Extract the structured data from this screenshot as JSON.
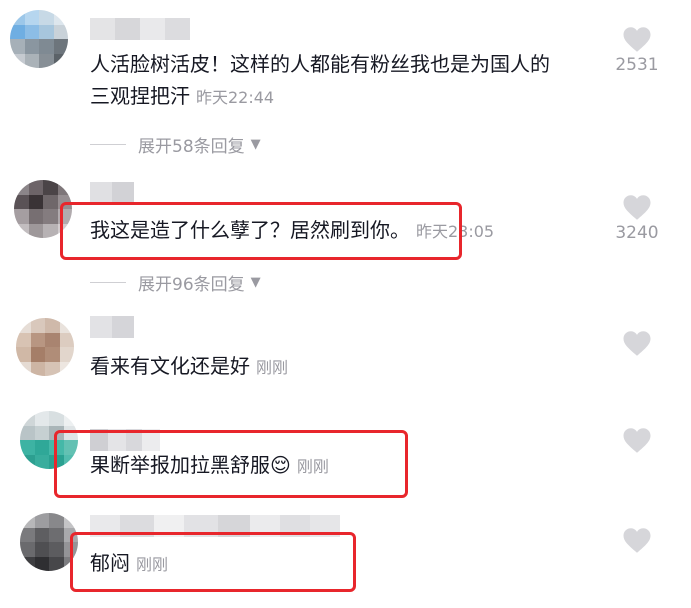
{
  "comments": [
    {
      "text_line1": "人活脸树活皮！这样的人都能有粉丝我也是为国人的",
      "text_line2": "三观捏把汗",
      "time": "昨天22:44",
      "likes": "2531",
      "replies_label": "展开58条回复"
    },
    {
      "text": "我这是造了什么孽了？居然刷到你。",
      "time": "昨天23:05",
      "likes": "3240",
      "replies_label": "展开96条回复"
    },
    {
      "text": "看来有文化还是好",
      "time": "刚刚",
      "likes": ""
    },
    {
      "text": "果断举报加拉黑舒服",
      "emoji": "😌",
      "time": "刚刚",
      "likes": ""
    },
    {
      "text": "郁闷",
      "time": "刚刚",
      "likes": ""
    }
  ],
  "icons": {
    "like": "heart-icon",
    "expand": "triangle-down-icon"
  },
  "colors": {
    "highlight": "#e8262c",
    "meta_text": "#9a9aa1",
    "body_text": "#161823",
    "heart": "#d6d6da"
  },
  "expand_arrow": "▼"
}
